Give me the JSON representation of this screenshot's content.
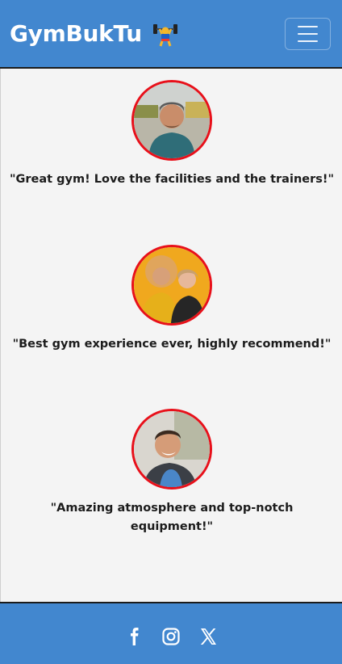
{
  "navbar": {
    "brand": "GymBukTu",
    "brand_icon": "weightlifter-icon",
    "menu_icon": "hamburger-menu-icon"
  },
  "testimonials": [
    {
      "quote": "\"Great gym! Love the facilities and the trainers!\"",
      "avatar": "man-avatar"
    },
    {
      "quote": "\"Best gym experience ever, highly recommend!\"",
      "avatar": "two-women-avatar"
    },
    {
      "quote": "\"Amazing atmosphere and top-notch equipment!\"",
      "avatar": "smiling-man-avatar"
    }
  ],
  "footer": {
    "social": [
      "facebook-icon",
      "instagram-icon",
      "x-icon"
    ]
  },
  "colors": {
    "primary": "#4287cf",
    "avatar_border": "#e8101a",
    "background": "#f4f4f4"
  }
}
